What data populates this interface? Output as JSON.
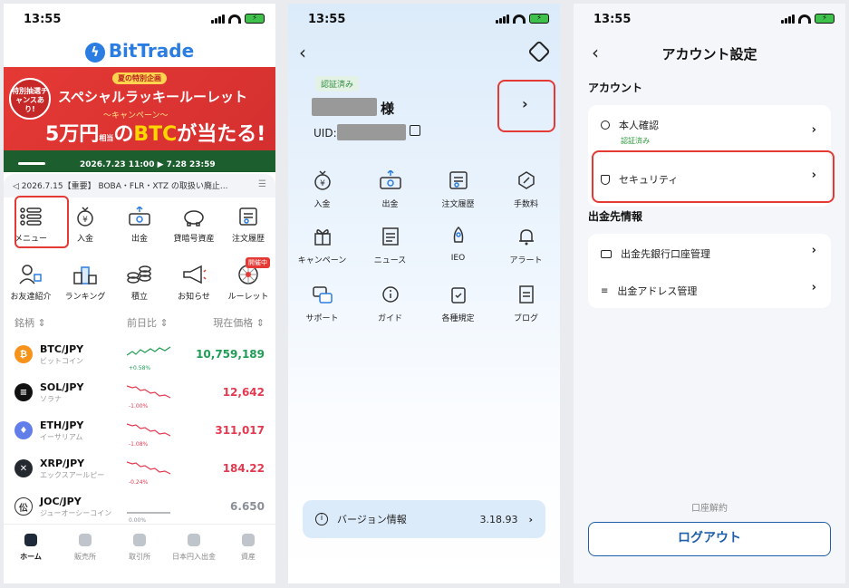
{
  "status": {
    "time": "13:55"
  },
  "screen1": {
    "logo": "BitTrade",
    "banner": {
      "tag": "特別抽選チャンスあり!",
      "subtitle": "夏の特別企画",
      "title": "スペシャルラッキールーレット",
      "campaign": "〜キャンペーン〜",
      "amount": "5万円",
      "amount_note": "相当",
      "mid": "の",
      "btc": "BTC",
      "win": "が当たる!",
      "dates": "2026.7.23 11:00 ▶ 7.28 23:59"
    },
    "ticker": "2026.7.15【重要】 BOBA・FLR・XTZ の取扱い廃止...",
    "shortcuts_row1": [
      {
        "label": "メニュー",
        "icon": "menu-icon"
      },
      {
        "label": "入金",
        "icon": "deposit-icon"
      },
      {
        "label": "出金",
        "icon": "withdraw-icon"
      },
      {
        "label": "貸暗号資産",
        "icon": "piggy-bank-icon"
      },
      {
        "label": "注文履歴",
        "icon": "order-history-icon"
      }
    ],
    "shortcuts_row2": [
      {
        "label": "お友達紹介",
        "icon": "referral-icon"
      },
      {
        "label": "ランキング",
        "icon": "ranking-icon"
      },
      {
        "label": "積立",
        "icon": "coins-icon"
      },
      {
        "label": "お知らせ",
        "icon": "megaphone-icon"
      },
      {
        "label": "ルーレット",
        "icon": "roulette-icon"
      }
    ],
    "new_badge": "開催中",
    "market_header": {
      "col1": "銘柄 ⇕",
      "col2": "前日比 ⇕",
      "col3": "現在価格 ⇕"
    },
    "markets": [
      {
        "pair": "BTC/JPY",
        "name": "ビットコイン",
        "change": "+0.58%",
        "price": "10,759,189",
        "color": "#1f9d55",
        "coin_color": "#f7931a",
        "symbol": "₿",
        "trend": "up"
      },
      {
        "pair": "SOL/JPY",
        "name": "ソラナ",
        "change": "-1.00%",
        "price": "12,642",
        "color": "#e53950",
        "coin_color": "#111111",
        "symbol": "≡",
        "trend": "down"
      },
      {
        "pair": "ETH/JPY",
        "name": "イーサリアム",
        "change": "-1.08%",
        "price": "311,017",
        "color": "#e53950",
        "coin_color": "#627eea",
        "symbol": "♦",
        "trend": "down"
      },
      {
        "pair": "XRP/JPY",
        "name": "エックスアールピー",
        "change": "-0.24%",
        "price": "184.22",
        "color": "#e53950",
        "coin_color": "#23292f",
        "symbol": "✕",
        "trend": "down"
      },
      {
        "pair": "JOC/JPY",
        "name": "ジューオーシーコイン",
        "change": "0.00%",
        "price": "6.650",
        "color": "#8a8f98",
        "coin_color": "#ffffff",
        "symbol": "伀",
        "trend": "flat"
      }
    ],
    "tabs": [
      "ホーム",
      "販売所",
      "取引所",
      "日本円入出金",
      "資産"
    ]
  },
  "screen2": {
    "verified": "認証済み",
    "honorific": "様",
    "uid_label": "UID:",
    "grid_row1": [
      {
        "label": "入金",
        "icon": "deposit-icon"
      },
      {
        "label": "出金",
        "icon": "withdraw-icon"
      },
      {
        "label": "注文履歴",
        "icon": "order-history-icon"
      },
      {
        "label": "手数料",
        "icon": "fee-icon"
      }
    ],
    "grid_row2": [
      {
        "label": "キャンペーン",
        "icon": "gift-icon"
      },
      {
        "label": "ニュース",
        "icon": "news-icon"
      },
      {
        "label": "IEO",
        "icon": "rocket-icon"
      },
      {
        "label": "アラート",
        "icon": "bell-icon"
      }
    ],
    "grid_row3": [
      {
        "label": "サポート",
        "icon": "support-icon"
      },
      {
        "label": "ガイド",
        "icon": "guide-icon"
      },
      {
        "label": "各種規定",
        "icon": "rules-icon"
      },
      {
        "label": "ブログ",
        "icon": "blog-icon"
      }
    ],
    "version_label": "バージョン情報",
    "version": "3.18.93"
  },
  "screen3": {
    "title": "アカウント設定",
    "section_account": "アカウント",
    "identity": "本人確認",
    "identity_status": "認証済み",
    "security": "セキュリティ",
    "section_withdraw": "出金先情報",
    "bank": "出金先銀行口座管理",
    "address": "出金アドレス管理",
    "close_account": "口座解約",
    "logout": "ログアウト"
  },
  "colors": {
    "accent": "#2b7de1",
    "highlight": "#e53935",
    "green": "#1f9d55",
    "red": "#e53950"
  }
}
